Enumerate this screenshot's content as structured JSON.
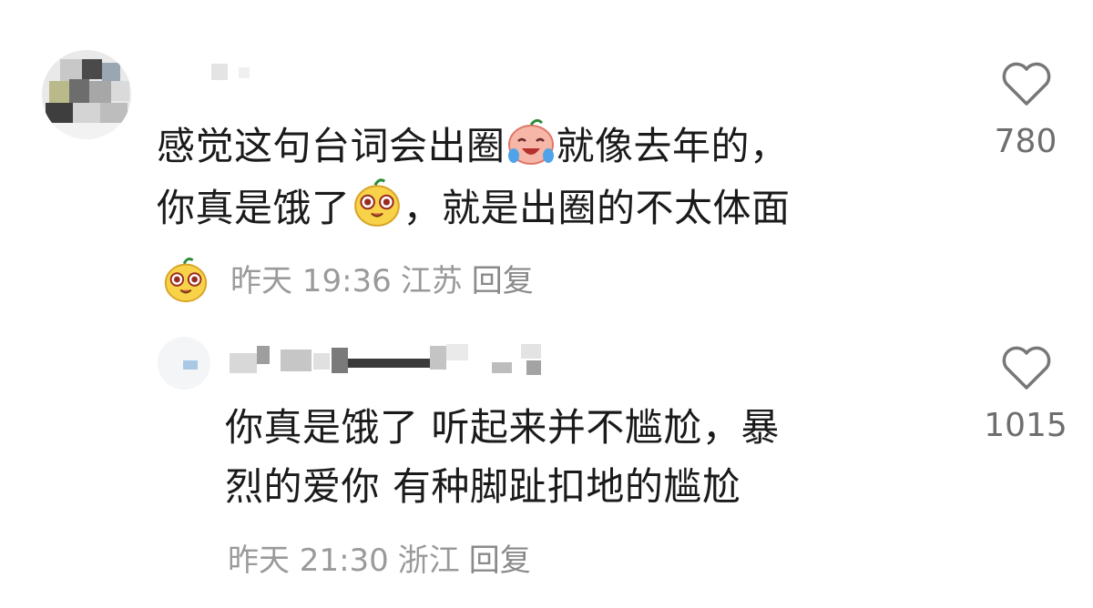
{
  "comments": [
    {
      "line1_pre": "感觉这句台词会出圈",
      "emoji1": "laughing-crying-peach-emoji",
      "line1_post": "就像去年的，",
      "line2_pre": "你真是饿了",
      "emoji2": "hungry-peach-emoji",
      "line2_post": "，就是出圈的不太体面",
      "emoji3": "hungry-peach-emoji",
      "time": "昨天 19:36",
      "location": "江苏",
      "reply": "回复",
      "likes": "780"
    },
    {
      "line1": "你真是饿了 听起来并不尴尬，暴",
      "line2": "烈的爱你 有种脚趾扣地的尴尬",
      "time": "昨天 21:30",
      "location": "浙江",
      "reply": "回复",
      "likes": "1015"
    }
  ],
  "icons": {
    "like": "heart-outline-icon"
  },
  "colors": {
    "text": "#1a1a1a",
    "meta": "#9a9a9a",
    "icon": "#777777"
  }
}
